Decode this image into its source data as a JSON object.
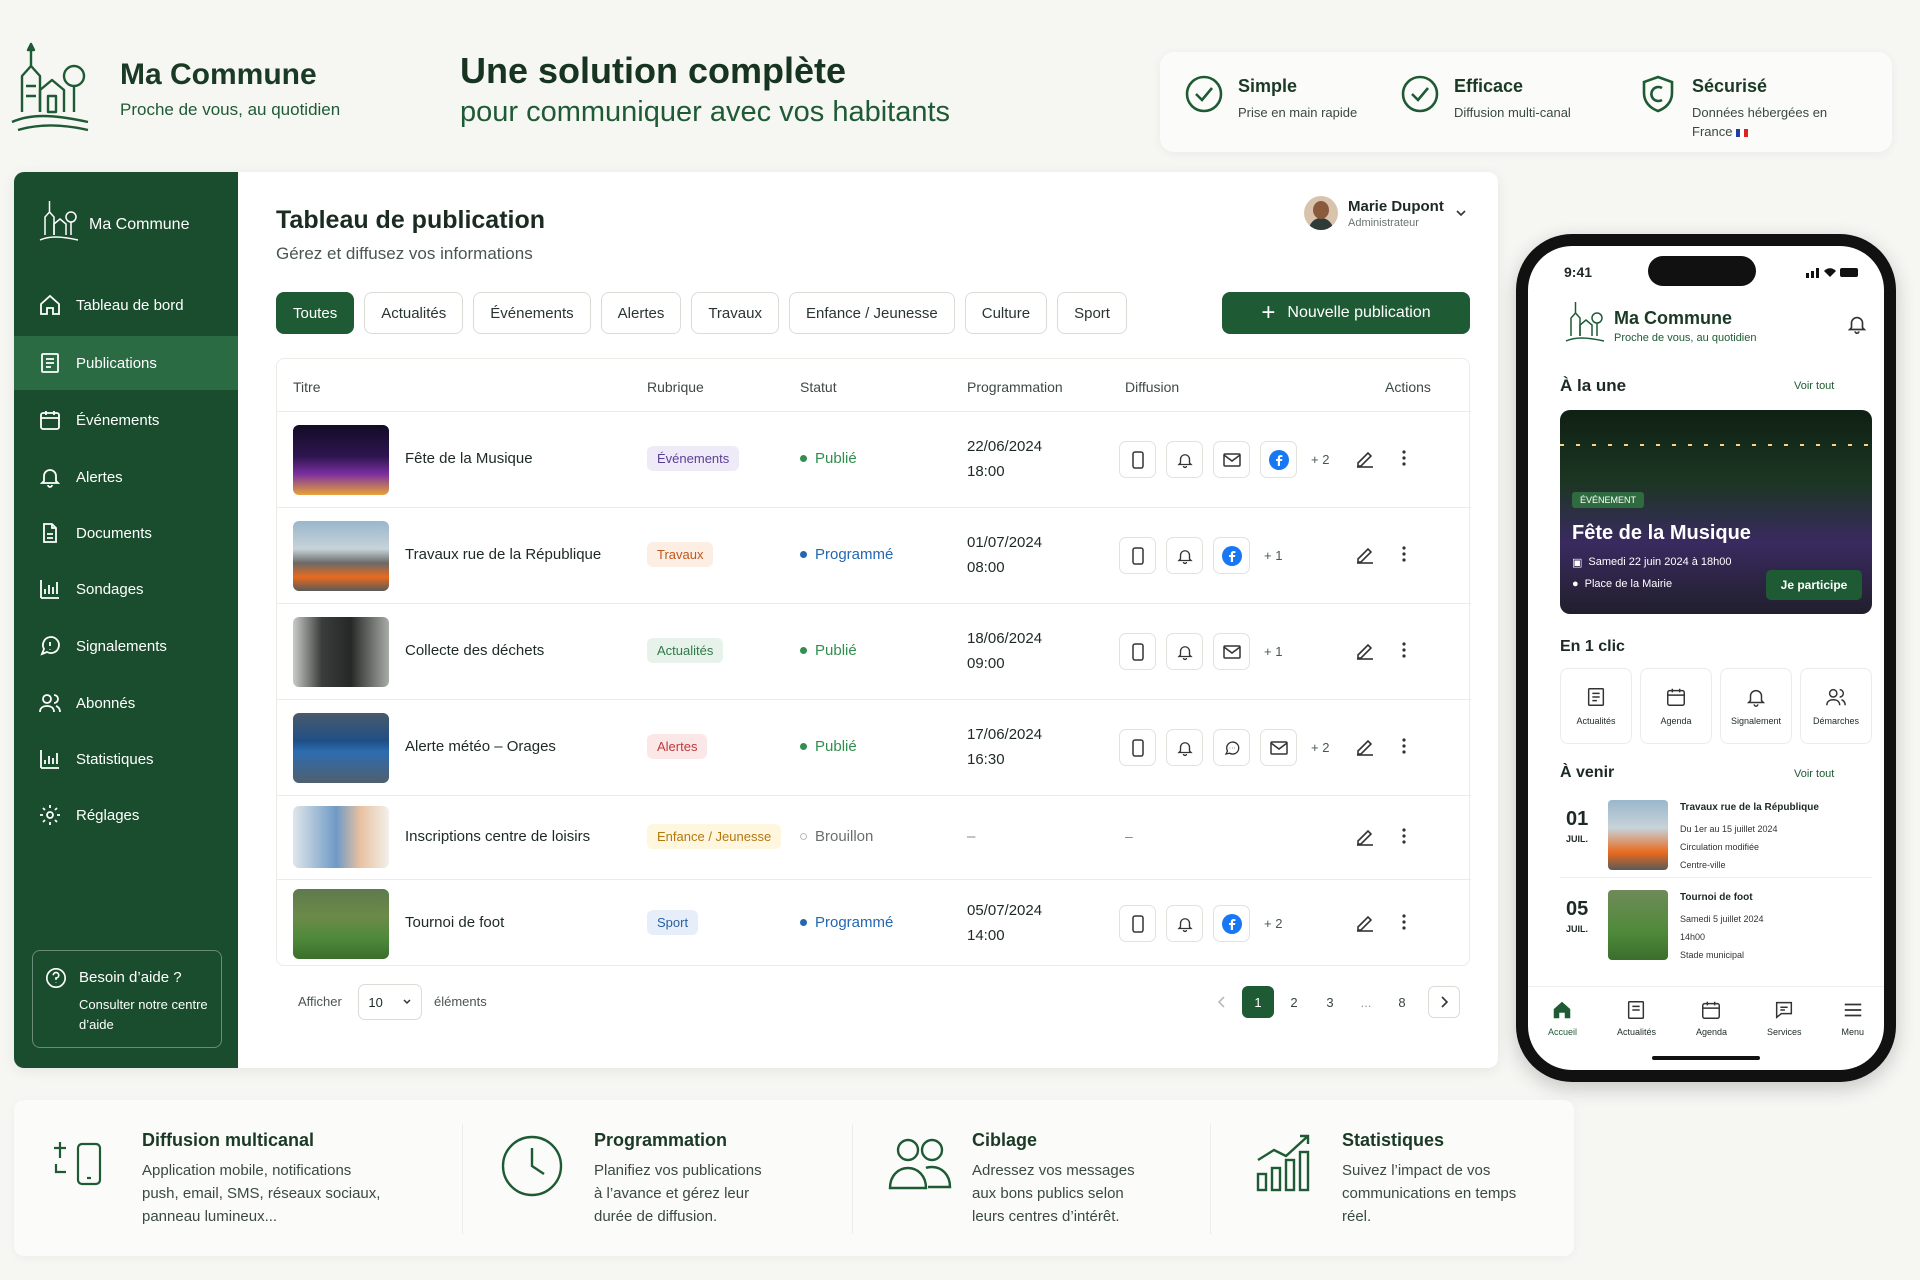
{
  "brand": {
    "name": "Ma Commune",
    "tagline": "Proche de vous, au quotidien"
  },
  "hero": {
    "line1": "Une solution complète",
    "line2": "pour communiquer avec vos habitants"
  },
  "features": [
    {
      "title": "Simple",
      "desc": "Prise en main rapide",
      "icon": "check-circle-icon"
    },
    {
      "title": "Efficace",
      "desc": "Diffusion multi-canal",
      "icon": "check-circle-icon"
    },
    {
      "title": "Sécurisé",
      "desc": "Données hébergées en",
      "desc2": "France",
      "icon": "shield-icon"
    }
  ],
  "sidebar": {
    "name": "Ma Commune",
    "items": [
      {
        "label": "Tableau de bord",
        "icon": "home-icon"
      },
      {
        "label": "Publications",
        "icon": "publications-icon",
        "active": true
      },
      {
        "label": "Événements",
        "icon": "calendar-icon"
      },
      {
        "label": "Alertes",
        "icon": "bell-icon"
      },
      {
        "label": "Documents",
        "icon": "document-icon"
      },
      {
        "label": "Sondages",
        "icon": "poll-icon"
      },
      {
        "label": "Signalements",
        "icon": "report-icon"
      },
      {
        "label": "Abonnés",
        "icon": "users-icon"
      },
      {
        "label": "Statistiques",
        "icon": "stats-icon"
      },
      {
        "label": "Réglages",
        "icon": "gear-icon"
      }
    ],
    "help": {
      "title": "Besoin d’aide ?",
      "desc": "Consulter notre centre d’aide"
    }
  },
  "main": {
    "title": "Tableau de publication",
    "subtitle": "Gérez et diffusez vos informations",
    "user": {
      "name": "Marie Dupont",
      "role": "Administrateur"
    },
    "filters": [
      "Toutes",
      "Actualités",
      "Événements",
      "Alertes",
      "Travaux",
      "Enfance / Jeunesse",
      "Culture",
      "Sport"
    ],
    "new_button": "Nouvelle publication",
    "columns": [
      "Titre",
      "Rubrique",
      "Statut",
      "Programmation",
      "Diffusion",
      "Actions"
    ],
    "rows": [
      {
        "title": "Fête de la Musique",
        "category": "Événements",
        "status": "Publié",
        "date": "22/06/2024",
        "time": "18:00",
        "channels": [
          "mobile",
          "bell",
          "mail",
          "facebook"
        ],
        "more": "+ 2"
      },
      {
        "title": "Travaux rue de la République",
        "category": "Travaux",
        "status": "Programmé",
        "date": "01/07/2024",
        "time": "08:00",
        "channels": [
          "mobile",
          "bell",
          "facebook"
        ],
        "more": "+ 1"
      },
      {
        "title": "Collecte des déchets",
        "category": "Actualités",
        "status": "Publié",
        "date": "18/06/2024",
        "time": "09:00",
        "channels": [
          "mobile",
          "bell",
          "mail"
        ],
        "more": "+ 1"
      },
      {
        "title": "Alerte météo – Orages",
        "category": "Alertes",
        "status": "Publié",
        "date": "17/06/2024",
        "time": "16:30",
        "channels": [
          "mobile",
          "bell",
          "chat",
          "mail"
        ],
        "more": "+ 2"
      },
      {
        "title": "Inscriptions centre de loisirs",
        "category": "Enfance / Jeunesse",
        "status": "Brouillon",
        "date": "–",
        "time": "",
        "channels": [],
        "more": "–"
      },
      {
        "title": "Tournoi de foot",
        "category": "Sport",
        "status": "Programmé",
        "date": "05/07/2024",
        "time": "14:00",
        "channels": [
          "mobile",
          "bell",
          "facebook"
        ],
        "more": "+ 2"
      }
    ],
    "pager": {
      "show_label": "Afficher",
      "page_size": "10",
      "items_label": "éléments",
      "pages": [
        "1",
        "2",
        "3",
        "...",
        "8"
      ],
      "current": "1"
    }
  },
  "phone": {
    "time": "9:41",
    "app_name": "Ma Commune",
    "tagline": "Proche de vous, au quotidien",
    "featured_title": "À la une",
    "see_all": "Voir tout",
    "featured": {
      "badge": "ÉVÉNEMENT",
      "title": "Fête de la Musique",
      "date": "Samedi 22 juin 2024 à 18h00",
      "place": "Place de la Mairie",
      "cta": "Je participe"
    },
    "quick_title": "En 1 clic",
    "quick": [
      {
        "label": "Actualités",
        "icon": "news-icon"
      },
      {
        "label": "Agenda",
        "icon": "calendar-icon"
      },
      {
        "label": "Signalement",
        "icon": "bell-icon"
      },
      {
        "label": "Démarches",
        "icon": "users-icon"
      }
    ],
    "upcoming_title": "À venir",
    "upcoming": [
      {
        "day": "01",
        "month": "JUIL.",
        "title": "Travaux rue de la République",
        "l1": "Du 1er au 15 juillet 2024",
        "l2": "Circulation modifiée",
        "l3": "Centre-ville"
      },
      {
        "day": "05",
        "month": "JUIL.",
        "title": "Tournoi de foot",
        "l1": "Samedi 5 juillet 2024",
        "l2": "14h00",
        "l3": "Stade municipal"
      }
    ],
    "tabs": [
      "Accueil",
      "Actualités",
      "Agenda",
      "Services",
      "Menu"
    ]
  },
  "bottom": [
    {
      "title": "Diffusion multicanal",
      "desc": [
        "Application mobile, notifications",
        "push, email, SMS, réseaux sociaux,",
        "panneau lumineux..."
      ]
    },
    {
      "title": "Programmation",
      "desc": [
        "Planifiez vos publications",
        "à l’avance et gérez leur",
        "durée de diffusion."
      ]
    },
    {
      "title": "Ciblage",
      "desc": [
        "Adressez vos messages",
        "aux bons publics selon",
        "leurs centres d’intérêt."
      ]
    },
    {
      "title": "Statistiques",
      "desc": [
        "Suivez l’impact de vos",
        "communications en temps",
        "réel."
      ]
    }
  ],
  "colors": {
    "primary": "#1e5b34",
    "sidebar": "#1a4d2e",
    "published": "#2f8f4e",
    "scheduled": "#2367b3",
    "facebook": "#1877f2"
  }
}
